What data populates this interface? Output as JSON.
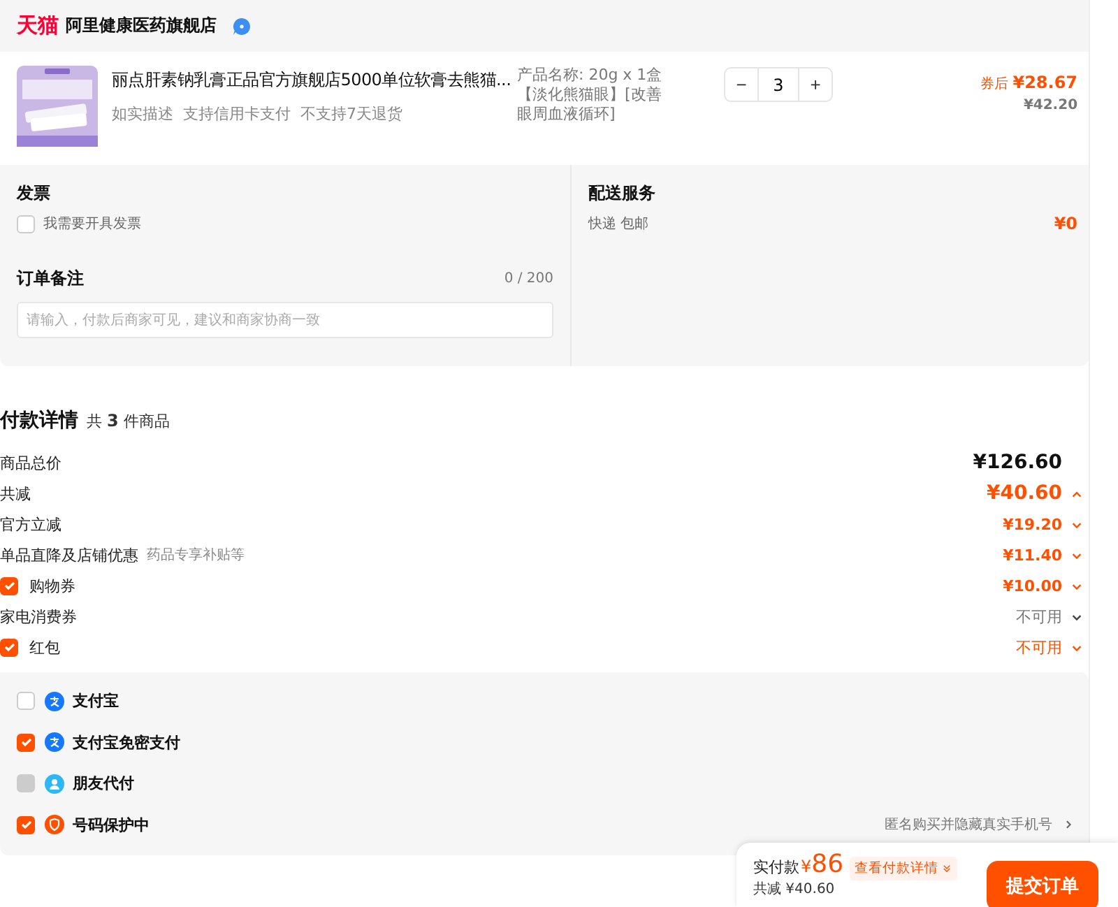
{
  "store": {
    "brand": "天猫",
    "name": "阿里健康医药旗舰店"
  },
  "product": {
    "title": "丽点肝素钠乳膏正品官方旗舰店5000单位软膏去熊猫...",
    "tags": [
      "如实描述",
      "支持信用卡支付",
      "不支持7天退货"
    ],
    "spec": "产品名称: 20g x 1盒【淡化熊猫眼】[改善眼周血液循环]",
    "quantity": "3",
    "minus": "−",
    "plus": "+",
    "coupon_label": "券后",
    "price": "¥28.67",
    "original_price": "¥42.20"
  },
  "invoice": {
    "title": "发票",
    "checkbox": {
      "label": "我需要开具发票",
      "checked": false
    }
  },
  "note": {
    "title": "订单备注",
    "counter": "0 / 200",
    "placeholder": "请输入，付款后商家可见，建议和商家协商一致"
  },
  "delivery": {
    "title": "配送服务",
    "method": "快递 包邮",
    "fee": "¥0"
  },
  "details": {
    "title": "付款详情",
    "count_prefix": "共",
    "count": "3",
    "count_suffix": "件商品",
    "rows": [
      {
        "kind": "total",
        "label": "商品总价",
        "value": "¥126.60"
      },
      {
        "kind": "reduction",
        "label": "共减",
        "value": "¥40.60",
        "expanded": true
      },
      {
        "kind": "discount",
        "label": "官方立减",
        "value": "¥19.20",
        "expanded": false
      },
      {
        "kind": "discount",
        "label": "单品直降及店铺优惠",
        "note": "药品专享补贴等",
        "value": "¥11.40",
        "expanded": false
      },
      {
        "kind": "check",
        "label": "购物券",
        "checked": true,
        "value": "¥10.00",
        "expanded": false
      },
      {
        "kind": "unavailable",
        "label": "家电消费券",
        "value": "不可用",
        "expanded": false
      },
      {
        "kind": "check-unavailable",
        "label": "红包",
        "checked": true,
        "value": "不可用",
        "expanded": false
      }
    ]
  },
  "options": [
    {
      "label": "支付宝",
      "kind": "alipay",
      "checked": false,
      "disabled": false
    },
    {
      "label": "支付宝免密支付",
      "kind": "alipay",
      "checked": true,
      "disabled": false
    },
    {
      "label": "朋友代付",
      "kind": "friend",
      "checked": false,
      "disabled": true
    },
    {
      "label": "号码保护中",
      "kind": "phone",
      "checked": true,
      "disabled": false,
      "hint": "匿名购买并隐藏真实手机号"
    }
  ],
  "summary": {
    "label": "实付款",
    "currency": "¥",
    "amount": "86",
    "detail_link": "查看付款详情",
    "saved": "共减 ¥40.60",
    "submit": "提交订单"
  }
}
